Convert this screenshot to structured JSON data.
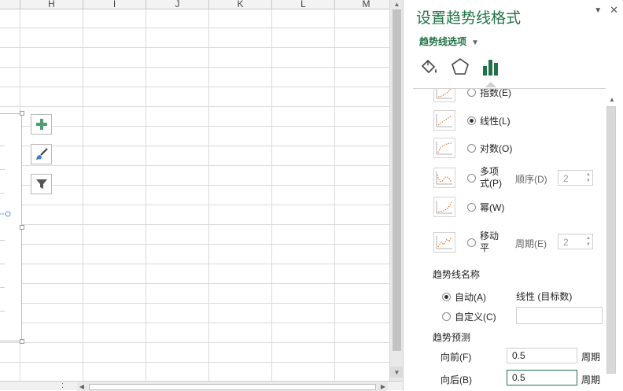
{
  "sheet": {
    "columns": [
      "H",
      "I",
      "J",
      "K",
      "L",
      "M"
    ],
    "chart_buttons": [
      {
        "name": "chart-elements",
        "icon": "plus-icon"
      },
      {
        "name": "chart-styles",
        "icon": "paintbrush-icon"
      },
      {
        "name": "chart-filters",
        "icon": "filter-icon"
      }
    ],
    "bottom_dots": ":"
  },
  "pane": {
    "title": "设置趋势线格式",
    "subtitle": "趋势线选项",
    "tabs": [
      {
        "name": "fill-line-tab",
        "icon": "paint-bucket-icon"
      },
      {
        "name": "effects-tab",
        "icon": "pentagon-icon"
      },
      {
        "name": "trendline-options-tab",
        "icon": "bar-chart-icon"
      }
    ],
    "trend_types": [
      {
        "label": "指数(E)",
        "selected": false,
        "icon": "exponential-trend-icon"
      },
      {
        "label": "线性(L)",
        "selected": true,
        "icon": "linear-trend-icon"
      },
      {
        "label": "对数(O)",
        "selected": false,
        "icon": "logarithmic-trend-icon"
      },
      {
        "label": "多项式(P)",
        "line1": "多项",
        "line2": "式(P)",
        "selected": false,
        "icon": "polynomial-trend-icon",
        "param_label": "顺序(D)",
        "param_value": "2"
      },
      {
        "label": "幂(W)",
        "selected": false,
        "icon": "power-trend-icon"
      },
      {
        "label": "移动平",
        "line1": "移动",
        "line2": "平",
        "selected": false,
        "icon": "moving-average-trend-icon",
        "param_label": "周期(E)",
        "param_value": "2"
      }
    ],
    "name_section": {
      "label": "趋势线名称",
      "auto_label": "自动(A)",
      "auto_selected": true,
      "auto_value": "线性 (目标数)",
      "custom_label": "自定义(C)",
      "custom_value": ""
    },
    "forecast": {
      "label": "趋势预测",
      "forward_label": "向前(F)",
      "forward_value": "0.5",
      "forward_unit": "周期",
      "backward_label": "向后(B)",
      "backward_value": "0.5",
      "backward_unit": "周期"
    }
  },
  "colors": {
    "accent": "#217346",
    "pane_border": "#d0d0d0"
  }
}
